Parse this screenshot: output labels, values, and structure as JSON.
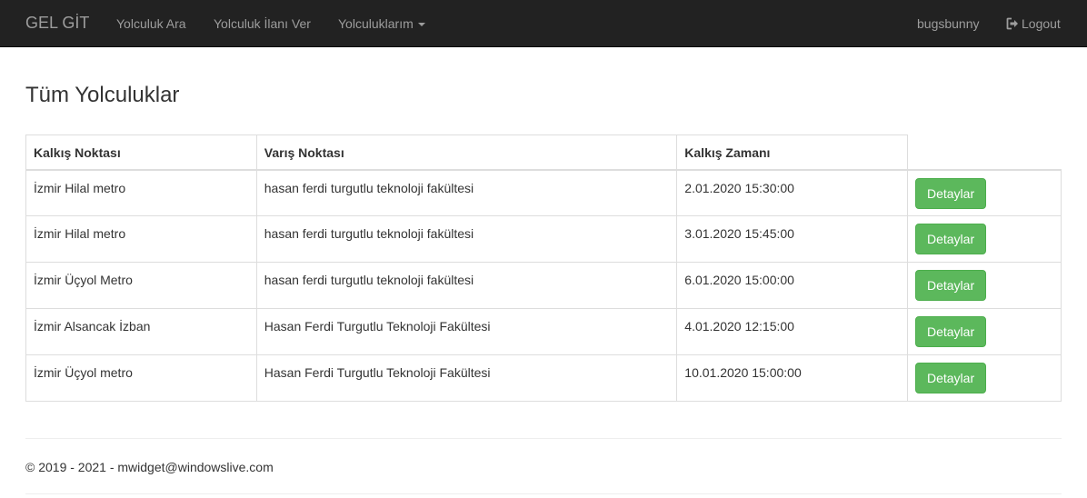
{
  "navbar": {
    "brand": "GEL GİT",
    "links": {
      "search": "Yolculuk Ara",
      "post": "Yolculuk İlanı Ver",
      "mine": "Yolculuklarım"
    },
    "user": "bugsbunny",
    "logout": "Logout",
    "background": "#222222"
  },
  "page": {
    "title": "Tüm Yolculuklar"
  },
  "table": {
    "headers": [
      "Kalkış Noktası",
      "Varış Noktası",
      "Kalkış Zamanı"
    ],
    "rows": [
      {
        "from": "İzmir Hilal metro",
        "to": "hasan ferdi turgutlu teknoloji fakültesi",
        "time": "2.01.2020 15:30:00",
        "action": "Detaylar"
      },
      {
        "from": "İzmir Hilal metro",
        "to": "hasan ferdi turgutlu teknoloji fakültesi",
        "time": "3.01.2020 15:45:00",
        "action": "Detaylar"
      },
      {
        "from": "İzmir Üçyol Metro",
        "to": "hasan ferdi turgutlu teknoloji fakültesi",
        "time": "6.01.2020 15:00:00",
        "action": "Detaylar"
      },
      {
        "from": "İzmir Alsancak İzban",
        "to": "Hasan Ferdi Turgutlu Teknoloji Fakültesi",
        "time": "4.01.2020 12:15:00",
        "action": "Detaylar"
      },
      {
        "from": "İzmir Üçyol metro",
        "to": "Hasan Ferdi Turgutlu Teknoloji Fakültesi",
        "time": "10.01.2020 15:00:00",
        "action": "Detaylar"
      }
    ],
    "button_color": "#5cb85c"
  },
  "footer": {
    "text": "© 2019 - 2021 - mwidget@windowslive.com"
  },
  "icons": {
    "dropdown": "caret-down-icon",
    "logout": "logout-icon"
  }
}
